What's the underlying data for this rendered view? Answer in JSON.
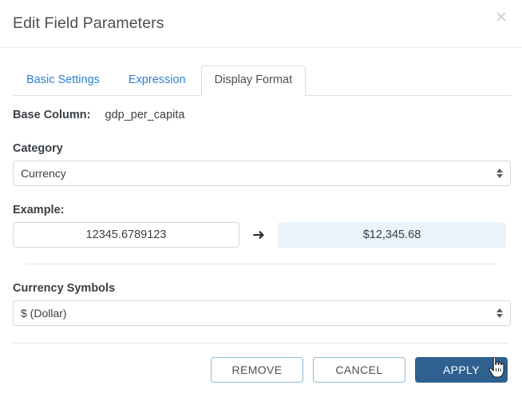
{
  "dialog": {
    "title": "Edit Field Parameters",
    "close_icon": "close-icon",
    "close_glyph": "✕"
  },
  "tabs": [
    {
      "label": "Basic Settings",
      "active": false
    },
    {
      "label": "Expression",
      "active": false
    },
    {
      "label": "Display Format",
      "active": true
    }
  ],
  "form": {
    "base_column": {
      "label": "Base Column:",
      "value": "gdp_per_capita"
    },
    "category": {
      "label": "Category",
      "selected": "Currency"
    },
    "example": {
      "label": "Example:",
      "input_value": "12345.6789123",
      "input_placeholder": "12345.6789123",
      "arrow_glyph": "➜",
      "result_value": "$12,345.68"
    },
    "currency_symbols": {
      "label": "Currency Symbols",
      "selected": "$ (Dollar)"
    }
  },
  "footer": {
    "remove_label": "REMOVE",
    "cancel_label": "CANCEL",
    "apply_label": "APPLY"
  },
  "colors": {
    "primary_button": "#2e6190",
    "secondary_border": "#8ebbd9",
    "tab_link": "#2f7fd1",
    "result_background": "#e9f4fc",
    "text": "#3a3f44",
    "divider": "#e6e6e6"
  },
  "cursor": {
    "icon": "pointing-hand-cursor"
  }
}
